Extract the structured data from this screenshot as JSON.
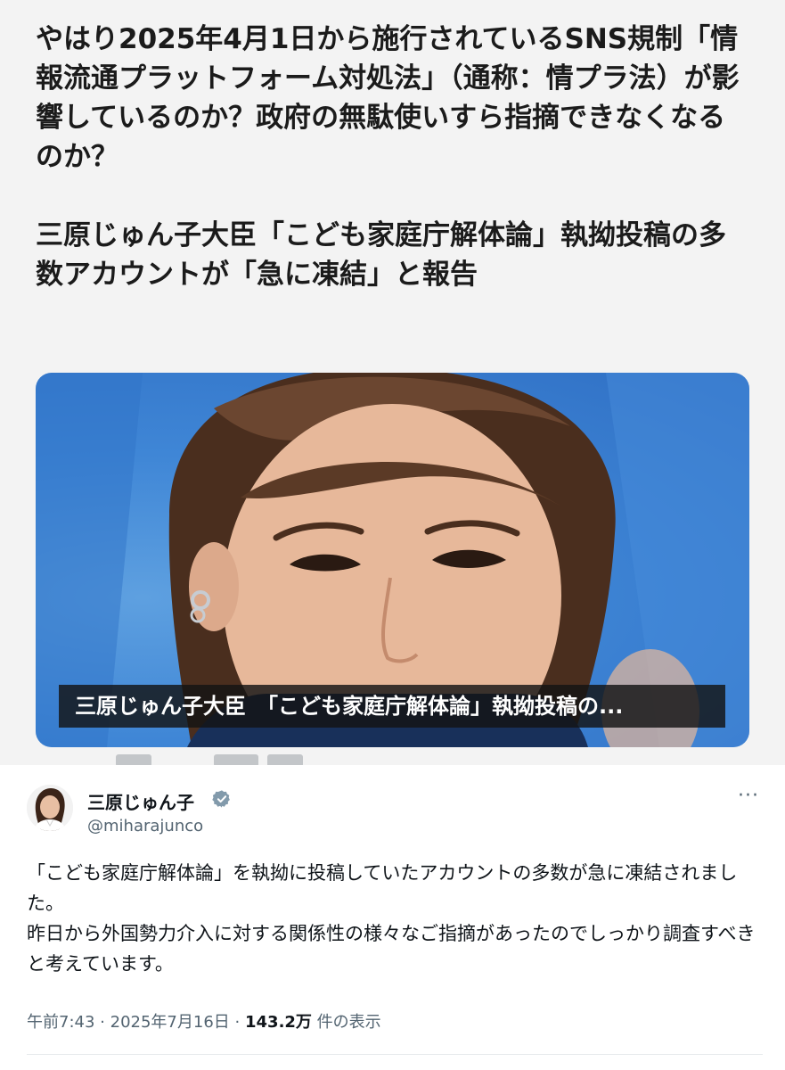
{
  "article": {
    "paragraph1": "やはり2025年4月1日から施行されているSNS規制「情報流通プラットフォーム対処法」（通称：情プラ法）が影響しているのか？政府の無駄使いすら指摘できなくなるのか？",
    "paragraph2": "三原じゅん子大臣「こども家庭庁解体論」執拗投稿の多数アカウントが「急に凍結」と報告",
    "photo_caption": "三原じゅん子大臣　「こども家庭庁解体論」執拗投稿の..."
  },
  "tweet": {
    "display_name": "三原じゅん子",
    "handle": "@miharajunco",
    "body_lines": [
      "「こども家庭庁解体論」を執拗に投稿していたアカウントの多数が急に凍結されました。",
      "昨日から外国勢力介入に対する関係性の様々なご指摘があったのでしっかり調査すべきと考えています。"
    ],
    "time": "午前7:43",
    "separator": "·",
    "date": "2025年7月16日",
    "views_count": "143.2万",
    "views_label": "件の表示",
    "icons": {
      "verified": "verified-badge-icon",
      "more": "more-options-icon"
    },
    "colors": {
      "verified": "#829aab",
      "secondary_text": "#536471"
    }
  }
}
